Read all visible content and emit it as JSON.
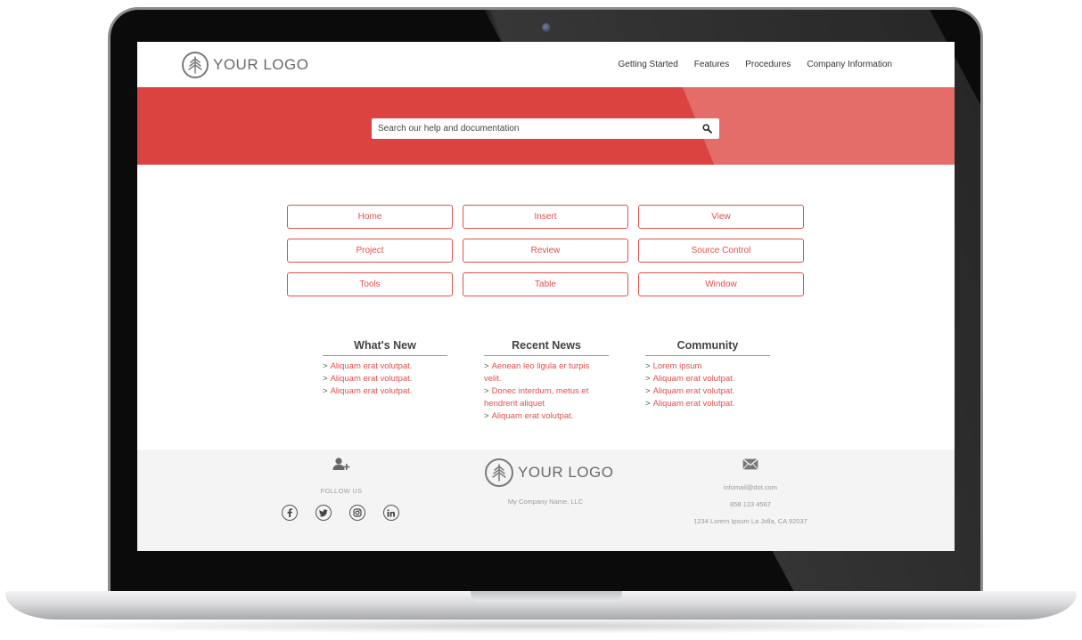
{
  "header": {
    "logo_text": "YOUR LOGO",
    "nav": [
      "Getting Started",
      "Features",
      "Procedures",
      "Company Information"
    ]
  },
  "hero": {
    "search_placeholder": "Search our help and documentation",
    "search_icon": "search-icon"
  },
  "categories": [
    "Home",
    "Insert",
    "View",
    "Project",
    "Review",
    "Source Control",
    "Tools",
    "Table",
    "Window"
  ],
  "columns": [
    {
      "title": "What's New",
      "links": [
        "Aliquam erat volutpat.",
        "Aliquam erat volutpat.",
        "Aliquam erat volutpat."
      ]
    },
    {
      "title": "Recent News",
      "links": [
        "Aenean leo ligula er turpis velit.",
        "Donec interdum, metus et hendrerit aliquet",
        "Aliquam erat volutpat."
      ]
    },
    {
      "title": "Community",
      "links": [
        "Lorem ipsum",
        "Aliquam erat volutpat.",
        "Aliquam erat volutpat.",
        "Aliquam erat volutpat."
      ]
    }
  ],
  "footer": {
    "follow_label": "FOLLOW US",
    "socials": [
      "facebook-icon",
      "twitter-icon",
      "instagram-icon",
      "linkedin-icon"
    ],
    "logo_text": "YOUR LOGO",
    "company": "My Company Name, LLC",
    "email": "infomail@dot.com",
    "phone": "858 123 4567",
    "address": "1234 Lorem Ipsum La Jolla, CA 92037"
  },
  "colors": {
    "accent": "#e0504c",
    "hero": "#db4340",
    "hero_tint": "#e46d69",
    "footer_bg": "#f4f4f4"
  }
}
